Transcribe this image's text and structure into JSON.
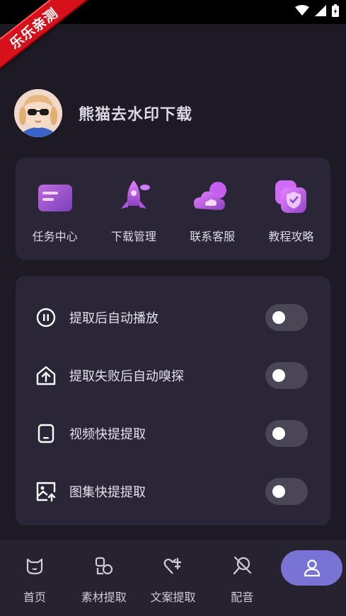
{
  "watermark": "乐乐亲测",
  "profile": {
    "name": "熊猫去水印下载"
  },
  "shortcuts": [
    {
      "label": "任务中心",
      "icon": "folder-icon"
    },
    {
      "label": "下载管理",
      "icon": "rocket-icon"
    },
    {
      "label": "联系客服",
      "icon": "cloud-icon"
    },
    {
      "label": "教程攻略",
      "icon": "shield-icon"
    }
  ],
  "settings": [
    {
      "label": "提取后自动播放",
      "icon": "pause-circle-icon",
      "enabled": false
    },
    {
      "label": "提取失败后自动嗅探",
      "icon": "upload-arrow-icon",
      "enabled": false
    },
    {
      "label": "视频快提提取",
      "icon": "tablet-icon",
      "enabled": false
    },
    {
      "label": "图集快提提取",
      "icon": "image-upload-icon",
      "enabled": false
    }
  ],
  "bottom_nav": [
    {
      "label": "首页",
      "icon": "cat-icon"
    },
    {
      "label": "素材提取",
      "icon": "shapes-icon"
    },
    {
      "label": "文案提取",
      "icon": "heart-edit-icon"
    },
    {
      "label": "配音",
      "icon": "microphone-off-icon"
    },
    {
      "label": "",
      "icon": "user-icon",
      "active": true
    }
  ],
  "colors": {
    "background": "#1d1a26",
    "card": "#2b2637",
    "accent": "#7a73d6",
    "ribbon": "#d7111b"
  }
}
